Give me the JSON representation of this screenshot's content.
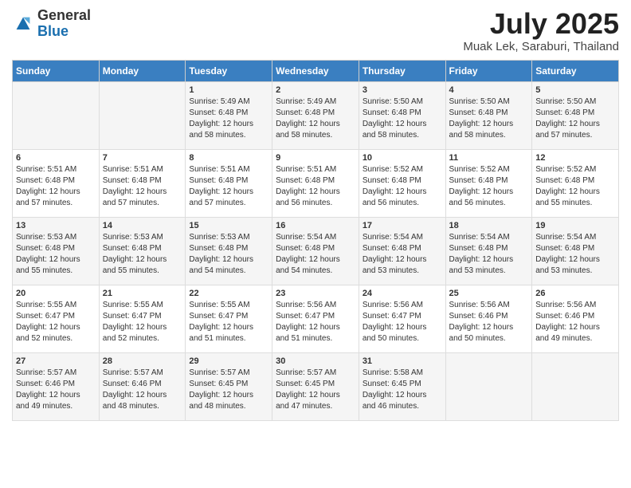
{
  "logo": {
    "general": "General",
    "blue": "Blue"
  },
  "title": "July 2025",
  "subtitle": "Muak Lek, Saraburi, Thailand",
  "days_of_week": [
    "Sunday",
    "Monday",
    "Tuesday",
    "Wednesday",
    "Thursday",
    "Friday",
    "Saturday"
  ],
  "weeks": [
    [
      {
        "day": "",
        "info": ""
      },
      {
        "day": "",
        "info": ""
      },
      {
        "day": "1",
        "info": "Sunrise: 5:49 AM\nSunset: 6:48 PM\nDaylight: 12 hours and 58 minutes."
      },
      {
        "day": "2",
        "info": "Sunrise: 5:49 AM\nSunset: 6:48 PM\nDaylight: 12 hours and 58 minutes."
      },
      {
        "day": "3",
        "info": "Sunrise: 5:50 AM\nSunset: 6:48 PM\nDaylight: 12 hours and 58 minutes."
      },
      {
        "day": "4",
        "info": "Sunrise: 5:50 AM\nSunset: 6:48 PM\nDaylight: 12 hours and 58 minutes."
      },
      {
        "day": "5",
        "info": "Sunrise: 5:50 AM\nSunset: 6:48 PM\nDaylight: 12 hours and 57 minutes."
      }
    ],
    [
      {
        "day": "6",
        "info": "Sunrise: 5:51 AM\nSunset: 6:48 PM\nDaylight: 12 hours and 57 minutes."
      },
      {
        "day": "7",
        "info": "Sunrise: 5:51 AM\nSunset: 6:48 PM\nDaylight: 12 hours and 57 minutes."
      },
      {
        "day": "8",
        "info": "Sunrise: 5:51 AM\nSunset: 6:48 PM\nDaylight: 12 hours and 57 minutes."
      },
      {
        "day": "9",
        "info": "Sunrise: 5:51 AM\nSunset: 6:48 PM\nDaylight: 12 hours and 56 minutes."
      },
      {
        "day": "10",
        "info": "Sunrise: 5:52 AM\nSunset: 6:48 PM\nDaylight: 12 hours and 56 minutes."
      },
      {
        "day": "11",
        "info": "Sunrise: 5:52 AM\nSunset: 6:48 PM\nDaylight: 12 hours and 56 minutes."
      },
      {
        "day": "12",
        "info": "Sunrise: 5:52 AM\nSunset: 6:48 PM\nDaylight: 12 hours and 55 minutes."
      }
    ],
    [
      {
        "day": "13",
        "info": "Sunrise: 5:53 AM\nSunset: 6:48 PM\nDaylight: 12 hours and 55 minutes."
      },
      {
        "day": "14",
        "info": "Sunrise: 5:53 AM\nSunset: 6:48 PM\nDaylight: 12 hours and 55 minutes."
      },
      {
        "day": "15",
        "info": "Sunrise: 5:53 AM\nSunset: 6:48 PM\nDaylight: 12 hours and 54 minutes."
      },
      {
        "day": "16",
        "info": "Sunrise: 5:54 AM\nSunset: 6:48 PM\nDaylight: 12 hours and 54 minutes."
      },
      {
        "day": "17",
        "info": "Sunrise: 5:54 AM\nSunset: 6:48 PM\nDaylight: 12 hours and 53 minutes."
      },
      {
        "day": "18",
        "info": "Sunrise: 5:54 AM\nSunset: 6:48 PM\nDaylight: 12 hours and 53 minutes."
      },
      {
        "day": "19",
        "info": "Sunrise: 5:54 AM\nSunset: 6:48 PM\nDaylight: 12 hours and 53 minutes."
      }
    ],
    [
      {
        "day": "20",
        "info": "Sunrise: 5:55 AM\nSunset: 6:47 PM\nDaylight: 12 hours and 52 minutes."
      },
      {
        "day": "21",
        "info": "Sunrise: 5:55 AM\nSunset: 6:47 PM\nDaylight: 12 hours and 52 minutes."
      },
      {
        "day": "22",
        "info": "Sunrise: 5:55 AM\nSunset: 6:47 PM\nDaylight: 12 hours and 51 minutes."
      },
      {
        "day": "23",
        "info": "Sunrise: 5:56 AM\nSunset: 6:47 PM\nDaylight: 12 hours and 51 minutes."
      },
      {
        "day": "24",
        "info": "Sunrise: 5:56 AM\nSunset: 6:47 PM\nDaylight: 12 hours and 50 minutes."
      },
      {
        "day": "25",
        "info": "Sunrise: 5:56 AM\nSunset: 6:46 PM\nDaylight: 12 hours and 50 minutes."
      },
      {
        "day": "26",
        "info": "Sunrise: 5:56 AM\nSunset: 6:46 PM\nDaylight: 12 hours and 49 minutes."
      }
    ],
    [
      {
        "day": "27",
        "info": "Sunrise: 5:57 AM\nSunset: 6:46 PM\nDaylight: 12 hours and 49 minutes."
      },
      {
        "day": "28",
        "info": "Sunrise: 5:57 AM\nSunset: 6:46 PM\nDaylight: 12 hours and 48 minutes."
      },
      {
        "day": "29",
        "info": "Sunrise: 5:57 AM\nSunset: 6:45 PM\nDaylight: 12 hours and 48 minutes."
      },
      {
        "day": "30",
        "info": "Sunrise: 5:57 AM\nSunset: 6:45 PM\nDaylight: 12 hours and 47 minutes."
      },
      {
        "day": "31",
        "info": "Sunrise: 5:58 AM\nSunset: 6:45 PM\nDaylight: 12 hours and 46 minutes."
      },
      {
        "day": "",
        "info": ""
      },
      {
        "day": "",
        "info": ""
      }
    ]
  ]
}
